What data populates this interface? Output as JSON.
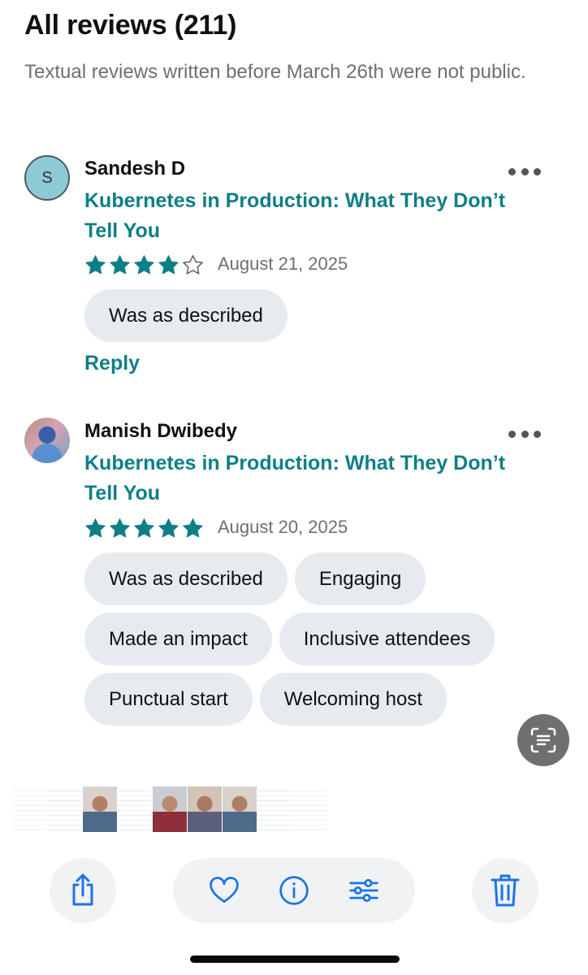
{
  "header": {
    "title": "All reviews (211)",
    "subtitle": "Textual reviews written before March 26th were not public."
  },
  "reviews": [
    {
      "avatar_letter": "S",
      "name": "Sandesh D",
      "event_title": "Kubernetes in Production: What They Don’t Tell You",
      "rating": 4,
      "rating_max": 5,
      "date": "August 21, 2025",
      "tags": [
        "Was as described"
      ],
      "reply_label": "Reply"
    },
    {
      "avatar_letter": "",
      "name": "Manish Dwibedy",
      "event_title": "Kubernetes in Production: What They Don’t Tell You",
      "rating": 5,
      "rating_max": 5,
      "date": "August 20, 2025",
      "tags": [
        "Was as described",
        "Engaging",
        "Made an impact",
        "Inclusive attendees",
        "Punctual start",
        "Welcoming host"
      ]
    }
  ],
  "colors": {
    "accent": "#0e7f85",
    "chip_bg": "#e7eaee",
    "muted_text": "#6f6f6f",
    "ios_blue": "#1a73e8",
    "toolbar_bg": "#f1f2f4"
  },
  "icons": {
    "more": "more-horizontal-icon",
    "star": "star-icon",
    "scan": "live-text-scan-icon",
    "share": "share-icon",
    "favorite": "heart-icon",
    "info": "info-icon",
    "adjust": "adjust-sliders-icon",
    "delete": "trash-icon"
  }
}
